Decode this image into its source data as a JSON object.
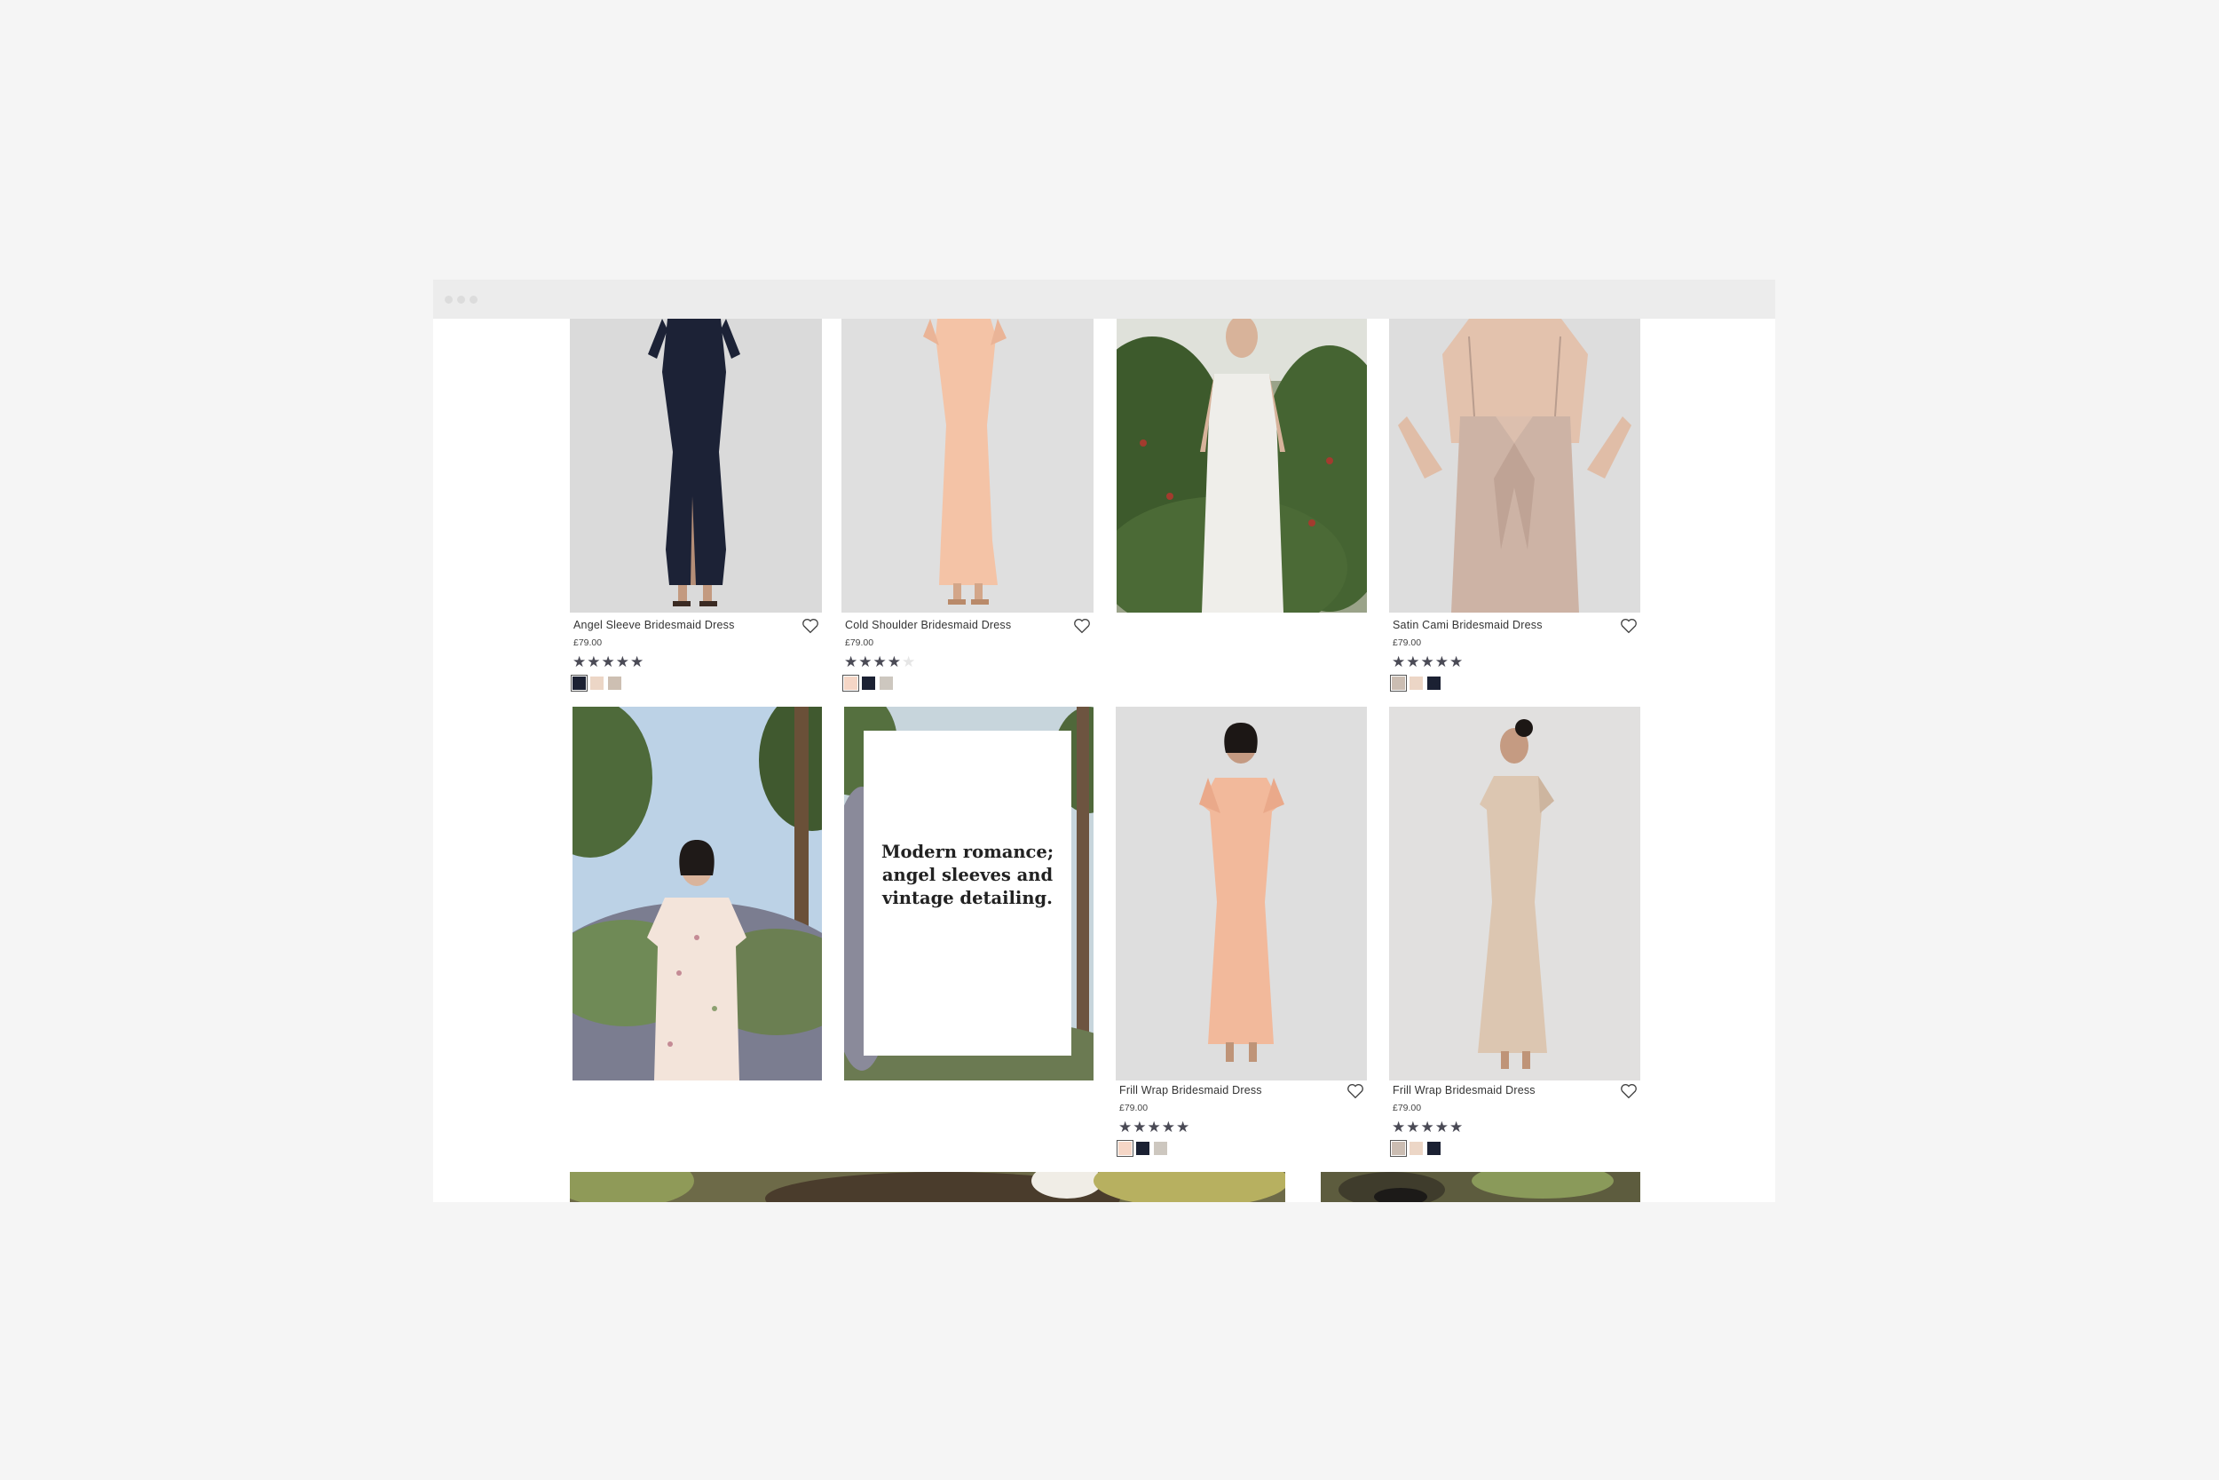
{
  "products": [
    {
      "name": "Angel Sleeve Bridesmaid Dress",
      "price": "£79.00",
      "rating": 5,
      "swatches": [
        "#1b2133",
        "#ecd6c6",
        "#cdbfb2"
      ],
      "image": "navy-maxi-dress-photo"
    },
    {
      "name": "Cold Shoulder Bridesmaid Dress",
      "price": "£79.00",
      "rating": 4,
      "swatches": [
        "#f5d6c6",
        "#1b2133",
        "#cdc7bf"
      ],
      "image": "peach-maxi-dress-photo"
    },
    {
      "image": "ivory-satin-dress-garden-photo"
    },
    {
      "name": "Satin Cami Bridesmaid Dress",
      "price": "£79.00",
      "rating": 5,
      "swatches": [
        "#cbbdb2",
        "#ecd6c6",
        "#1b2133"
      ],
      "image": "taupe-tie-back-dress-photo"
    },
    {
      "image": "floral-flutter-sleeve-dress-meadow-photo"
    },
    {
      "image": "promo-panel-photo"
    },
    {
      "name": "Frill Wrap Bridesmaid Dress",
      "price": "£79.00",
      "rating": 5,
      "swatches": [
        "#f5d6c6",
        "#1b2133",
        "#cdc7bf"
      ],
      "image": "peach-frill-wrap-dress-photo"
    },
    {
      "name": "Frill Wrap Bridesmaid Dress",
      "price": "£79.00",
      "rating": 5,
      "swatches": [
        "#cbbdb2",
        "#ecd6c6",
        "#1b2133"
      ],
      "image": "champagne-frill-wrap-dress-photo"
    }
  ],
  "promo": {
    "text": "Modern romance; angel sleeves and vintage detailing."
  },
  "stars": {
    "on": "★★★★★",
    "four_on": "★★★★",
    "four_off": "★"
  },
  "colors": {
    "background": "#f5f5f5",
    "titlebar": "#ececec",
    "star": "#4a4a55",
    "text": "#333333"
  }
}
